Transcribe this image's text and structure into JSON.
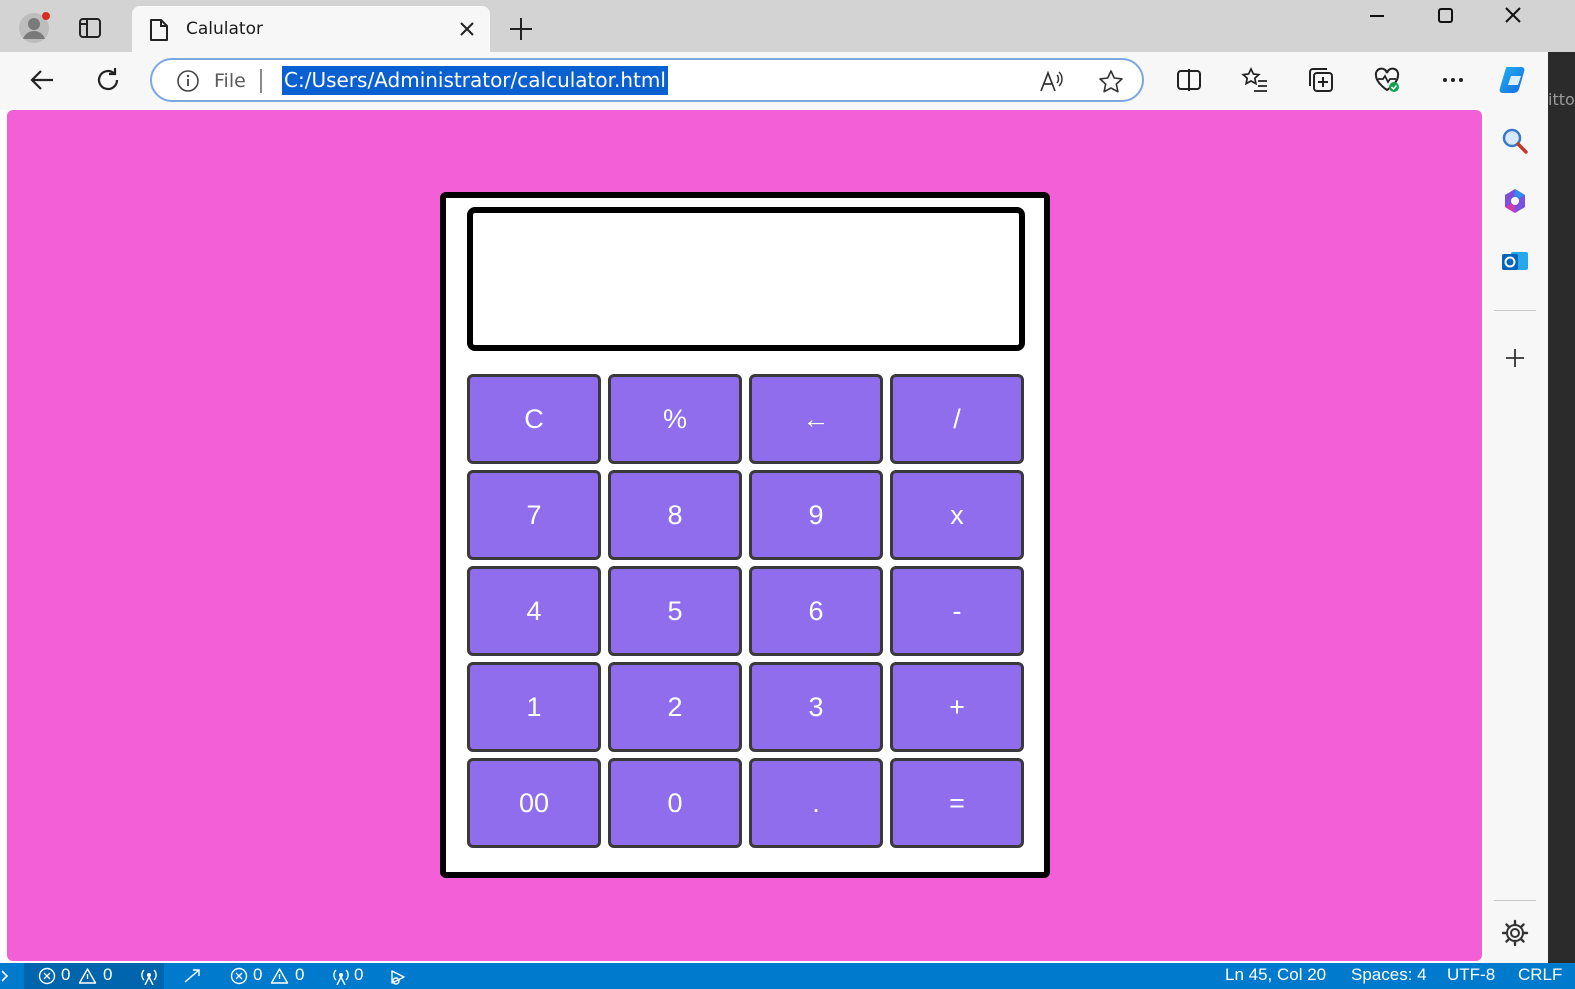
{
  "browser": {
    "tab_title": "Calulator",
    "address_prefix": "File",
    "url": "C:/Users/Administrator/calculator.html",
    "accent_color": "#0a5fd1"
  },
  "sidebar_edge_text": "itto",
  "page": {
    "background_color": "#f35fd6",
    "display_value": "",
    "key_color": "#8f6ded",
    "keys": [
      {
        "label": "C"
      },
      {
        "label": "%"
      },
      {
        "label": "←"
      },
      {
        "label": "/"
      },
      {
        "label": "7"
      },
      {
        "label": "8"
      },
      {
        "label": "9"
      },
      {
        "label": "x"
      },
      {
        "label": "4"
      },
      {
        "label": "5"
      },
      {
        "label": "6"
      },
      {
        "label": "-"
      },
      {
        "label": "1"
      },
      {
        "label": "2"
      },
      {
        "label": "3"
      },
      {
        "label": "+"
      },
      {
        "label": "00"
      },
      {
        "label": "0"
      },
      {
        "label": "."
      },
      {
        "label": "="
      }
    ]
  },
  "statusbar": {
    "errors_1": "0",
    "warnings_1": "0",
    "errors_2": "0",
    "warnings_2": "0",
    "ports": "0",
    "cursor": "Ln 45, Col 20",
    "spaces": "Spaces: 4",
    "encoding": "UTF-8",
    "eol": "CRLF"
  }
}
